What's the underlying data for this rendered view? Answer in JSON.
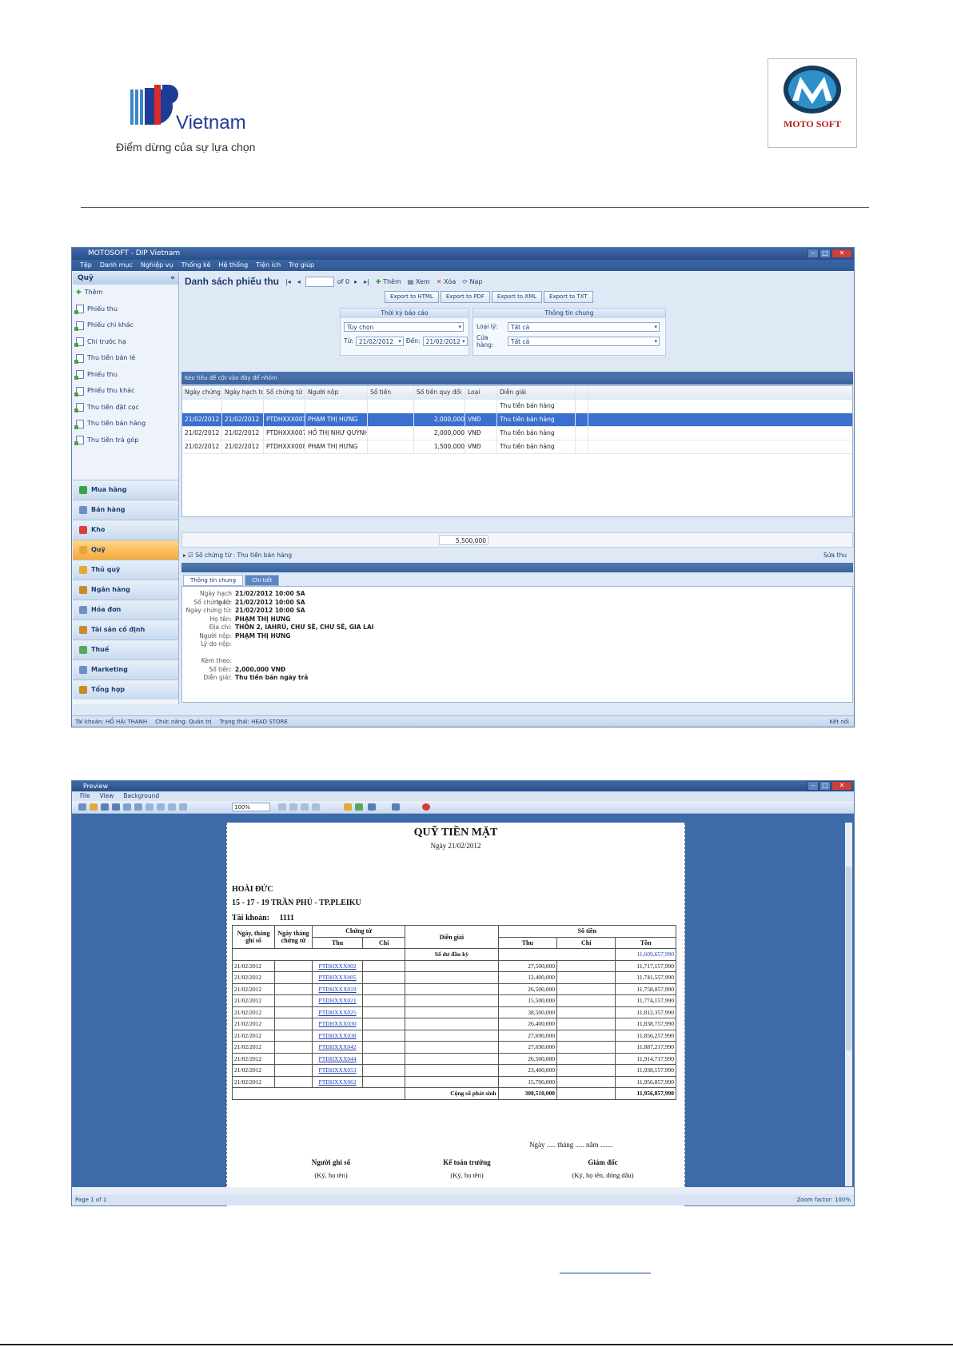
{
  "header": {
    "brand_name": "Vietnam",
    "slogan": "Điểm dừng của sự lựa chọn",
    "partner_logo_text": "MOTO SOFT"
  },
  "app": {
    "title": "MOTOSOFT - DIP Vietnam",
    "menu": [
      "Tệp",
      "Danh mục",
      "Nghiệp vụ",
      "Thống kê",
      "Hệ thống",
      "Tiện ích",
      "Trợ giúp"
    ],
    "sidebar": {
      "heading": "Quỹ",
      "items": [
        "Thêm",
        "Phiếu thu",
        "Phiếu chi khác",
        "Chi trước hạ",
        "Thu tiền bán lẻ",
        "Phiếu thu",
        "Phiếu thu khác",
        "Thu tiền đặt cọc",
        "Thu tiền bán hàng",
        "Thu tiền trả góp"
      ],
      "nav": [
        "Mua hàng",
        "Bán hàng",
        "Kho",
        "Quỹ",
        "Thủ quỹ",
        "Ngân hàng",
        "Hóa đơn",
        "Tài sản cố định",
        "Thuế",
        "Marketing",
        "Tổng hợp"
      ],
      "active_nav": "Quỹ"
    },
    "pane_title": "Danh sách phiếu thu",
    "toolbar": {
      "page_of": "of 0",
      "add": "Thêm",
      "view": "Xem",
      "delete": "Xóa",
      "refresh": "Nạp"
    },
    "export_buttons": [
      "Export to HTML",
      "Export to PDF",
      "Export to XML",
      "Export to TXT"
    ],
    "report_period": {
      "heading": "Thời kỳ báo cáo",
      "option": "Tùy chọn",
      "from_label": "Từ:",
      "from": "21/02/2012",
      "to_label": "Đến:",
      "to": "21/02/2012"
    },
    "general_info": {
      "heading": "Thông tin chung",
      "type_label": "Loại lý:",
      "type_value": "Tất cả",
      "store_label": "Cửa hàng:",
      "store_value": "Tất cả"
    },
    "group_hint": "Kéo tiêu đề cột vào đây để nhóm",
    "grid": {
      "columns": [
        "Ngày chứng từ",
        "Ngày hạch toán",
        "Số chứng từ",
        "Người nộp",
        "Số tiền",
        "Số tiền quy đổi",
        "Loại",
        "Diễn giải",
        ""
      ],
      "rows": [
        [
          "",
          "",
          "",
          "",
          "",
          "",
          "",
          "Thu tiền bán hàng",
          ""
        ],
        [
          "21/02/2012",
          "21/02/2012",
          "PTDHXXX001",
          "PHẠM THỊ HƯNG",
          "",
          "2,000,000",
          "VNĐ",
          "Thu tiền bán hàng",
          ""
        ],
        [
          "21/02/2012",
          "21/02/2012",
          "PTDHXXX007",
          "HỒ THỊ NHƯ QUỲNH",
          "",
          "2,000,000",
          "VNĐ",
          "Thu tiền bán hàng",
          ""
        ],
        [
          "21/02/2012",
          "21/02/2012",
          "PTDHXXX008",
          "PHẠM THỊ HƯNG",
          "",
          "1,500,000",
          "VNĐ",
          "Thu tiền bán hàng",
          ""
        ]
      ],
      "selected_row": 1,
      "footer_total": "5,500,000"
    },
    "group_row": "Số chứng từ : Thu tiền bán hàng",
    "edit_label": "Sửa thu",
    "detail_tabs": [
      "Thông tin chung",
      "Chi tiết"
    ],
    "detail": [
      {
        "label": "Ngày hạch toán:",
        "value": "21/02/2012 10:00 SA"
      },
      {
        "label": "Số chứng từ:",
        "value": "21/02/2012 10:00 SA"
      },
      {
        "label": "Ngày chứng từ:",
        "value": "21/02/2012 10:00 SA"
      },
      {
        "label": "Họ tên:",
        "value": "PHẠM THỊ HƯNG"
      },
      {
        "label": "Địa chỉ:",
        "value": "THÔN 2, IAHRÚ, CHƯ SÊ, CHƯ SÊ, GIA LAI"
      },
      {
        "label": "Người nộp:",
        "value": "PHẠM THỊ HƯNG"
      },
      {
        "label": "Lý do nộp:",
        "value": ""
      },
      {
        "label": "",
        "value": ""
      },
      {
        "label": "Kèm theo:",
        "value": ""
      },
      {
        "label": "Số tiền:",
        "value": "2,000,000 VNĐ"
      },
      {
        "label": "Diễn giải:",
        "value": "Thu tiền bán ngày trả"
      }
    ],
    "status": [
      "Tài khoản: HỒ HẢI THANH",
      "Chức năng: Quản trị",
      "Trạng thái: HEAD STORE"
    ],
    "status_right": "Kết nối"
  },
  "preview": {
    "title": "Preview",
    "menu": [
      "File",
      "View",
      "Background"
    ],
    "zoom": "100%",
    "report": {
      "title": "QUỸ TIỀN MẶT",
      "date_line": "Ngày 21/02/2012",
      "company": "HOÀI ĐỨC",
      "address": "15 - 17 - 19 TRẦN PHÚ - TP.PLEIKU",
      "account_label": "Tài khoản:",
      "account": "1111",
      "headers": {
        "entry_date": "Ngày, tháng ghi sổ",
        "doc_date": "Ngày tháng chứng từ",
        "voucher": "Chứng từ",
        "in": "Thu",
        "out": "Chi",
        "desc": "Diễn giải",
        "amount": "Số tiền",
        "balance": "Tồn"
      },
      "opening_label": "Số dư đầu kỳ",
      "opening_balance": "11,609,657,990",
      "rows": [
        {
          "date": "21/02/2012",
          "voucher": "PTDHXXX002",
          "in": "27,500,000",
          "balance": "11,717,157,990"
        },
        {
          "date": "21/02/2012",
          "voucher": "PTDHXXX005",
          "in": "12,400,000",
          "balance": "11,741,557,990"
        },
        {
          "date": "21/02/2012",
          "voucher": "PTDHXXX019",
          "in": "26,500,000",
          "balance": "11,758,057,990"
        },
        {
          "date": "21/02/2012",
          "voucher": "PTDHXXX021",
          "in": "15,500,000",
          "balance": "11,774,157,990"
        },
        {
          "date": "21/02/2012",
          "voucher": "PTDHXXX025",
          "in": "38,500,000",
          "balance": "11,812,357,990"
        },
        {
          "date": "21/02/2012",
          "voucher": "PTDHXXX030",
          "in": "26,400,000",
          "balance": "11,838,757,990"
        },
        {
          "date": "21/02/2012",
          "voucher": "PTDHXXX038",
          "in": "27,690,000",
          "balance": "11,856,257,990"
        },
        {
          "date": "21/02/2012",
          "voucher": "PTDHXXX042",
          "in": "27,690,000",
          "balance": "11,887,217,990"
        },
        {
          "date": "21/02/2012",
          "voucher": "PTDHXXX044",
          "in": "26,500,000",
          "balance": "11,914,717,990"
        },
        {
          "date": "21/02/2012",
          "voucher": "PTDHXXX053",
          "in": "23,400,000",
          "balance": "11,938,157,990"
        },
        {
          "date": "21/02/2012",
          "voucher": "PTDHXXX062",
          "in": "15,790,000",
          "balance": "11,956,857,990"
        }
      ],
      "total_label": "Cộng số phát sinh",
      "total_in": "308,510,000",
      "total_balance": "11,956,857,990",
      "place_date": "Ngày ..... tháng ..... năm .......",
      "signers": [
        {
          "role": "Người ghi sổ",
          "note": "(Ký, họ tên)"
        },
        {
          "role": "Kế toán trưởng",
          "note": "(Ký, họ tên)"
        },
        {
          "role": "Giám đốc",
          "note": "(Ký, họ tên, đóng dấu)"
        }
      ]
    },
    "status_left": "Page 1 of 1",
    "status_right": "Zoom factor: 100%"
  }
}
